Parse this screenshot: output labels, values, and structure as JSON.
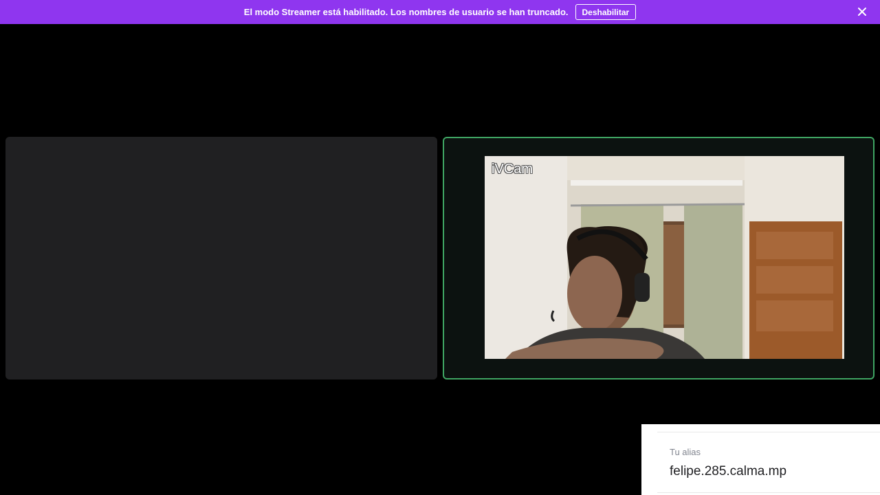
{
  "banner": {
    "message": "El modo Streamer está habilitado. Los nombres de usuario se han truncado.",
    "disable_label": "Deshabilitar",
    "close_icon": "close-icon",
    "color": "#8f36ef"
  },
  "video": {
    "watermark": "iVCam",
    "speaking_border_color": "#3fa563"
  },
  "alias": {
    "label": "Tu alias",
    "value": "felipe.285.calma.mp"
  }
}
